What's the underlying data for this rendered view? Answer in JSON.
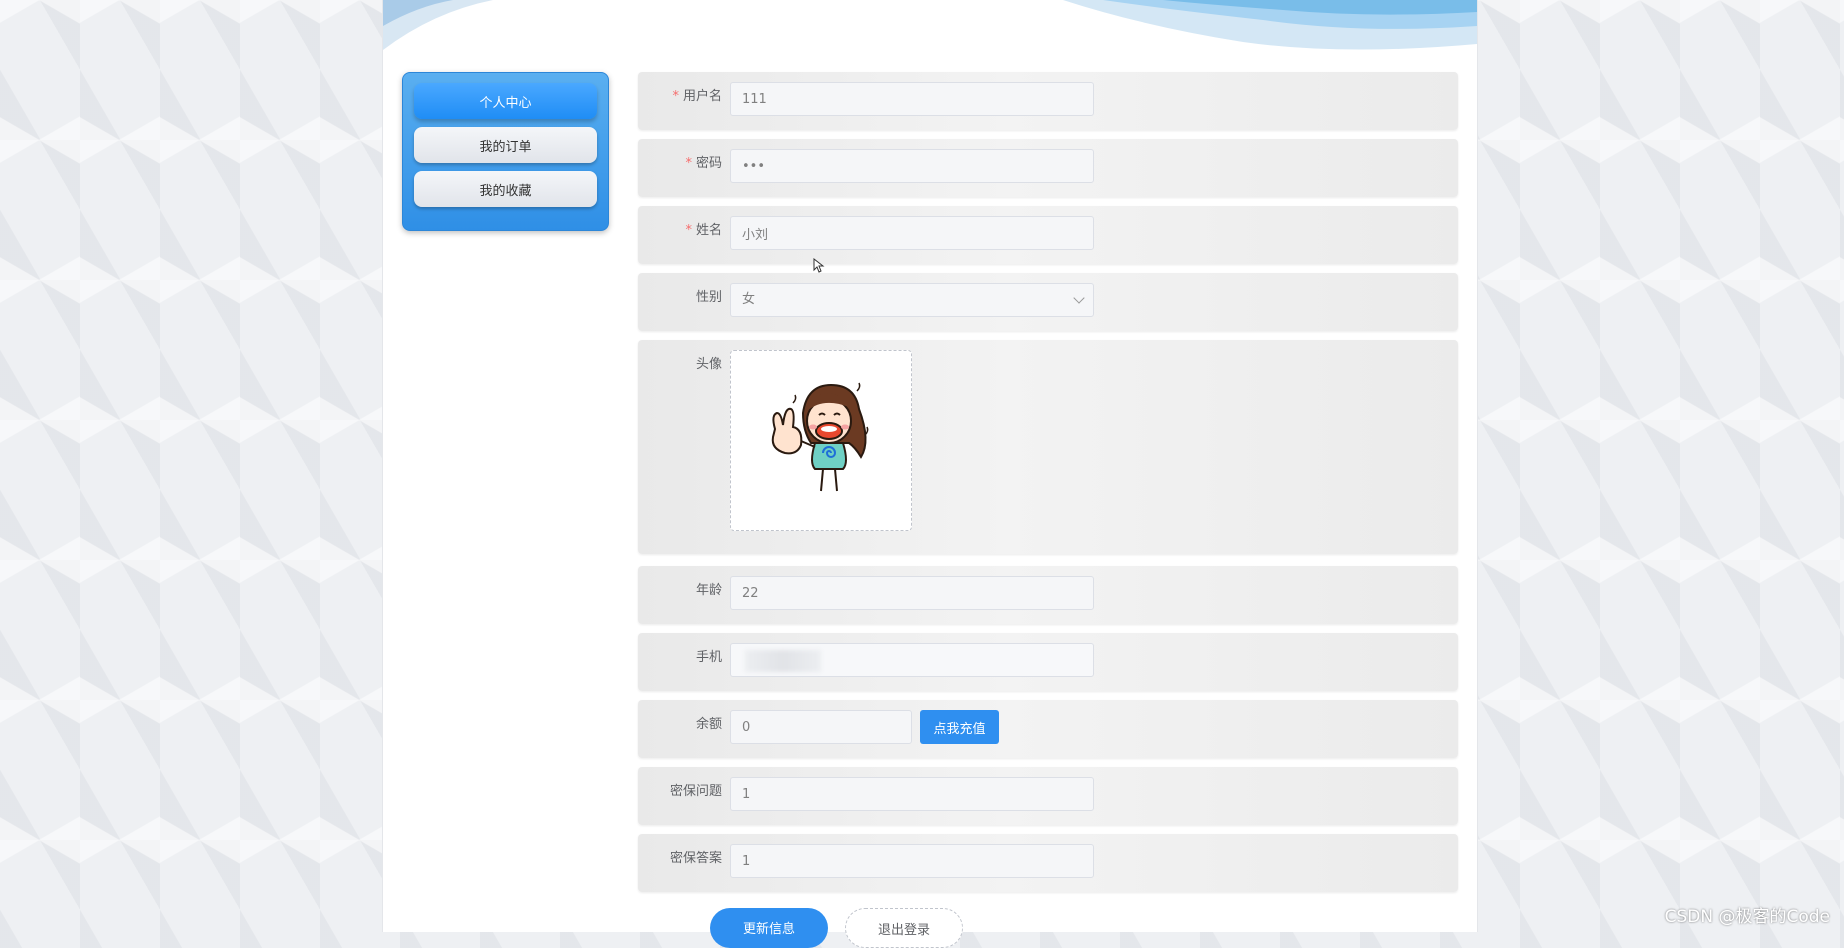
{
  "sidebar": {
    "items": [
      {
        "label": "个人中心",
        "active": true
      },
      {
        "label": "我的订单",
        "active": false
      },
      {
        "label": "我的收藏",
        "active": false
      }
    ]
  },
  "form": {
    "username": {
      "label": "用户名",
      "value": "111",
      "required": true
    },
    "password": {
      "label": "密码",
      "value": "•••",
      "required": true
    },
    "name": {
      "label": "姓名",
      "value": "小刘",
      "required": true
    },
    "gender": {
      "label": "性别",
      "value": "女"
    },
    "avatar": {
      "label": "头像"
    },
    "age": {
      "label": "年龄",
      "value": "22"
    },
    "phone": {
      "label": "手机",
      "value": ""
    },
    "balance": {
      "label": "余额",
      "value": "0",
      "recharge_label": "点我充值"
    },
    "security_question": {
      "label": "密保问题",
      "value": "1"
    },
    "security_answer": {
      "label": "密保答案",
      "value": "1"
    }
  },
  "actions": {
    "update_label": "更新信息",
    "logout_label": "退出登录"
  },
  "watermark": "CSDN @极客的Code",
  "colors": {
    "primary": "#2f8ff0",
    "required": "#f56c6c",
    "sidebar_bg": "#3d9beb"
  }
}
